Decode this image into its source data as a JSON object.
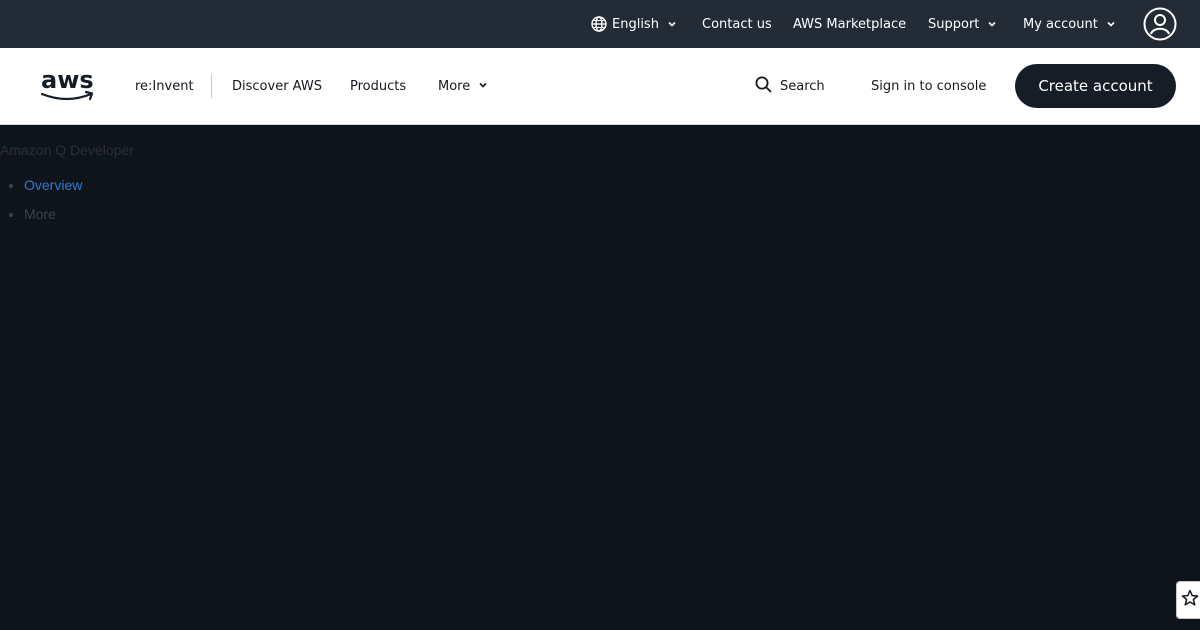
{
  "utility_bar": {
    "language": "English",
    "contact": "Contact us",
    "marketplace": "AWS Marketplace",
    "support": "Support",
    "account": "My account",
    "icons": [
      "globe-icon",
      "chevron-down-icon",
      "user-profile-icon"
    ]
  },
  "main_nav": {
    "logo_text": "aws",
    "items": [
      "re:Invent",
      "Discover AWS",
      "Products",
      "More"
    ],
    "search": "Search",
    "sign_in": "Sign in to console",
    "create_account": "Create account"
  },
  "content": {
    "title": "Amazon Q Developer",
    "list": [
      {
        "label": "Overview"
      },
      {
        "label": "More"
      }
    ]
  },
  "widgets": {
    "favorite_icon": "star-icon"
  },
  "colors": {
    "utility_bar_bg": "#232b37",
    "nav_bg": "#ffffff",
    "page_bg": "#0f141a",
    "button_bg": "#161d26",
    "link": "#2d7ad6"
  }
}
